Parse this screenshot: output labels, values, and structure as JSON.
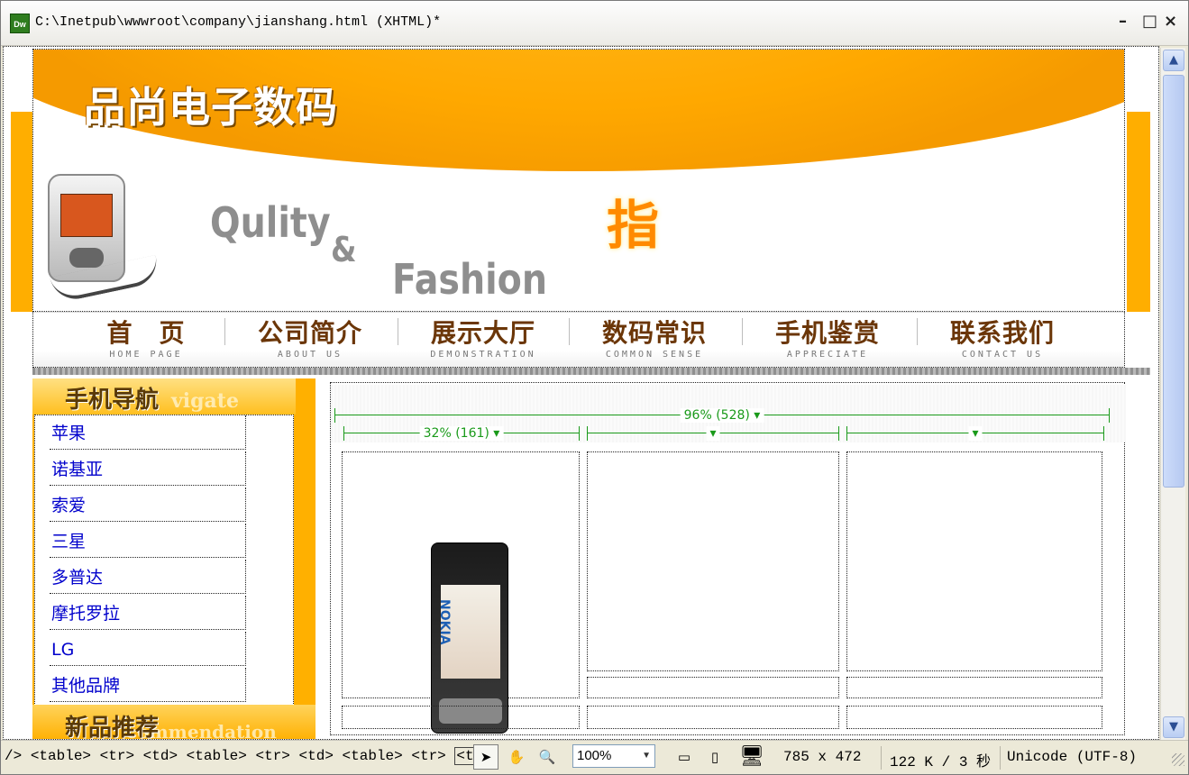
{
  "window": {
    "app_icon": "Dw",
    "title": "C:\\Inetpub\\wwwroot\\company\\jianshang.html (XHTML)*",
    "min": "–",
    "max": "□",
    "close": "×"
  },
  "banner": {
    "brand": "品尚电子数码",
    "slogan_1": "Qulity",
    "slogan_amp": "&",
    "slogan_2": "Fashion",
    "glyph": "指"
  },
  "nav": [
    {
      "cn": "首　页",
      "en": "HOME PAGE"
    },
    {
      "cn": "公司简介",
      "en": "ABOUT US"
    },
    {
      "cn": "展示大厅",
      "en": "DEMONSTRATION"
    },
    {
      "cn": "数码常识",
      "en": "COMMON SENSE"
    },
    {
      "cn": "手机鉴赏",
      "en": "APPRECIATE"
    },
    {
      "cn": "联系我们",
      "en": "CONTACT US"
    }
  ],
  "sidebar": {
    "heading": "手机导航",
    "heading_en": "vigate",
    "items": [
      "苹果",
      "诺基亚",
      "索爱",
      "三星",
      "多普达",
      "摩托罗拉",
      "LG",
      "其他品牌"
    ],
    "heading2": "新品推荐",
    "heading2_en": "commendation"
  },
  "content": {
    "table_width_label": "96% (528) ▾",
    "col1_width_label": "32% (161) ▾",
    "col_marker": "▾",
    "phone_brand": "NOKIA"
  },
  "statusbar": {
    "tags": [
      "/>",
      "<table>",
      "<tr>",
      "<td>",
      "<table>",
      "<tr>",
      "<td>",
      "<table>",
      "<tr>",
      "<td>"
    ],
    "zoom": "100%",
    "window_size": "785 x 472",
    "download": "122 K / 3 秒",
    "encoding": "Unicode (UTF-8)"
  }
}
